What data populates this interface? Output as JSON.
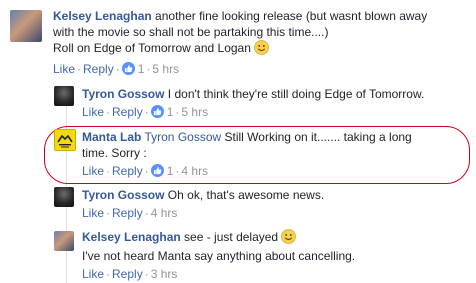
{
  "comments": [
    {
      "author": "Kelsey Lenaghan",
      "text_line1": "another fine looking release (but wasnt blown away",
      "text_line2": "with the movie so shall not be partaking this time....)",
      "text_line3": "Roll on Edge of Tomorrow and Logan",
      "like": "Like",
      "reply": "Reply",
      "like_count": "1",
      "time": "5 hrs"
    },
    {
      "author": "Tyron Gossow",
      "text": "I don't think they're still doing Edge of Tomorrow.",
      "like": "Like",
      "reply": "Reply",
      "like_count": "1",
      "time": "5 hrs"
    },
    {
      "author": "Manta Lab",
      "mention": "Tyron Gossow",
      "text_line1": "Still Working on it....... taking a long",
      "text_line2": "time. Sorry :",
      "like": "Like",
      "reply": "Reply",
      "like_count": "1",
      "time": "4 hrs"
    },
    {
      "author": "Tyron Gossow",
      "text": "Oh ok, that's awesome news.",
      "like": "Like",
      "reply": "Reply",
      "time": "4 hrs"
    },
    {
      "author": "Kelsey Lenaghan",
      "text_line1": "see - just delayed",
      "text_line2": "I've not heard Manta say anything about cancelling.",
      "like": "Like",
      "reply": "Reply",
      "time": "3 hrs"
    }
  ],
  "separator": "·",
  "colors": {
    "link": "#4267b2",
    "author": "#365899",
    "meta": "#90949c",
    "like_badge": "#5890ff",
    "highlight": "#d0021b"
  },
  "icons": [
    "like-thumb-icon",
    "smiley-icon"
  ]
}
